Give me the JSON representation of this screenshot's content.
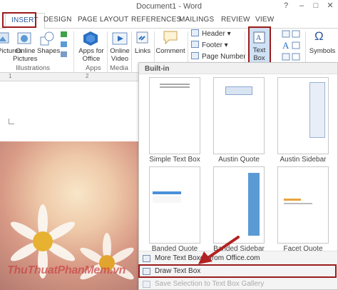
{
  "window": {
    "title": "Document1 - Word",
    "help": "?",
    "minimize": "–",
    "maximize": "□",
    "close": "✕"
  },
  "tabs": [
    "INSERT",
    "DESIGN",
    "PAGE LAYOUT",
    "REFERENCES",
    "MAILINGS",
    "REVIEW",
    "VIEW"
  ],
  "ribbon": {
    "pictures": "Pictures",
    "online_pictures_1": "Online",
    "online_pictures_2": "Pictures",
    "shapes": "Shapes",
    "apps_for_office_1": "Apps for",
    "apps_for_office_2": "Office",
    "online_video_1": "Online",
    "online_video_2": "Video",
    "links": "Links",
    "comment": "Comment",
    "header": "Header",
    "footer": "Footer",
    "page_number": "Page Number",
    "text_box_1": "Text",
    "text_box_2": "Box",
    "symbols": "Symbols",
    "symbol_glyph": "Ω",
    "groups": {
      "illustrations": "Illustrations",
      "apps": "Apps",
      "media": "Media"
    }
  },
  "ruler": {
    "marks": [
      "1",
      "2"
    ]
  },
  "gallery": {
    "header": "Built-in",
    "thumbnails": [
      {
        "label": "Simple Text Box"
      },
      {
        "label": "Austin Quote"
      },
      {
        "label": "Austin Sidebar"
      },
      {
        "label": "Banded Quote"
      },
      {
        "label": "Banded Sidebar"
      },
      {
        "label": "Facet Quote"
      }
    ],
    "menu": {
      "more": "More Text Boxes from Office.com",
      "draw": "Draw Text Box",
      "save": "Save Selection to Text Box Gallery"
    }
  },
  "watermark": "ThuThuatPhanMem.vn",
  "colors": {
    "accent": "#2b579a",
    "highlight": "#9b1c1c",
    "arrow": "#b22222"
  }
}
